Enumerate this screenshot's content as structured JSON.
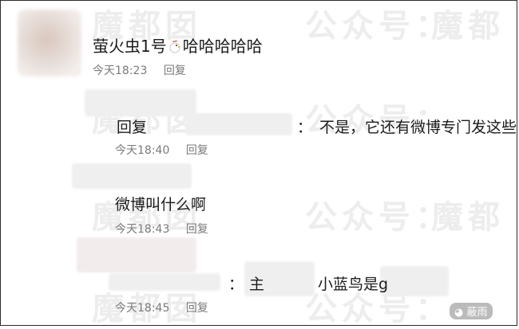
{
  "watermark": {
    "text_a": "魔都囡",
    "text_b": "公众号：",
    "text_c": "魔都"
  },
  "comments": [
    {
      "username": "萤火虫1号",
      "emoji_icon": "rooster-icon",
      "content": "哈哈哈哈哈",
      "time": "今天18:23",
      "reply_label": "回复"
    },
    {
      "prefix": "回复",
      "separator": "：",
      "content": "不是，它还有微博专门发这些",
      "time": "今天18:40",
      "reply_label": "回复"
    },
    {
      "content": "微博叫什么啊",
      "time": "今天18:43",
      "reply_label": "回复"
    },
    {
      "separator": "：",
      "content_a": "主",
      "content_b": "小蓝鸟是g",
      "time": "今天18:45",
      "reply_label": "回复"
    }
  ],
  "corner_logo": "蔽雨",
  "colors": {
    "text": "#1b1b1b",
    "meta": "#7a7a7a",
    "watermark": "#ededed",
    "blur": "#efefef"
  }
}
